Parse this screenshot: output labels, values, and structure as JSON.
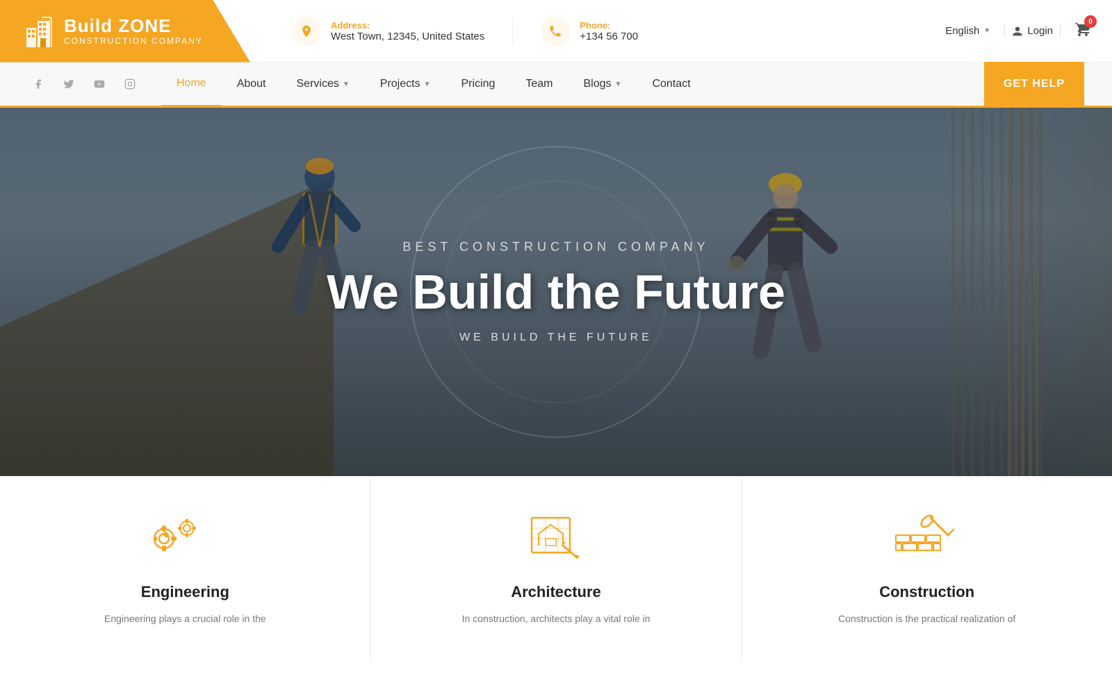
{
  "logo": {
    "title": "Build ZONE",
    "subtitle": "Construction Company"
  },
  "address": {
    "label": "Address:",
    "value": "West Town, 12345, United States"
  },
  "phone": {
    "label": "Phone:",
    "value": "+134 56 700"
  },
  "topRight": {
    "language": "English",
    "login": "Login",
    "cartCount": "0"
  },
  "nav": {
    "items": [
      {
        "label": "Home",
        "active": true,
        "hasDropdown": false
      },
      {
        "label": "About",
        "active": false,
        "hasDropdown": false
      },
      {
        "label": "Services",
        "active": false,
        "hasDropdown": true
      },
      {
        "label": "Projects",
        "active": false,
        "hasDropdown": true
      },
      {
        "label": "Pricing",
        "active": false,
        "hasDropdown": false
      },
      {
        "label": "Team",
        "active": false,
        "hasDropdown": false
      },
      {
        "label": "Blogs",
        "active": false,
        "hasDropdown": true
      },
      {
        "label": "Contact",
        "active": false,
        "hasDropdown": false
      }
    ],
    "cta": "GET HELP"
  },
  "hero": {
    "tagline": "BEST CONSTRUCTION COMPANY",
    "title": "We Build the Future",
    "subtitle": "WE BUILD THE FUTURE"
  },
  "services": [
    {
      "id": "engineering",
      "title": "Engineering",
      "description": "Engineering plays a crucial role in the"
    },
    {
      "id": "architecture",
      "title": "Architecture",
      "description": "In construction, architects play a vital role in"
    },
    {
      "id": "construction",
      "title": "Construction",
      "description": "Construction is the practical realization of"
    }
  ]
}
